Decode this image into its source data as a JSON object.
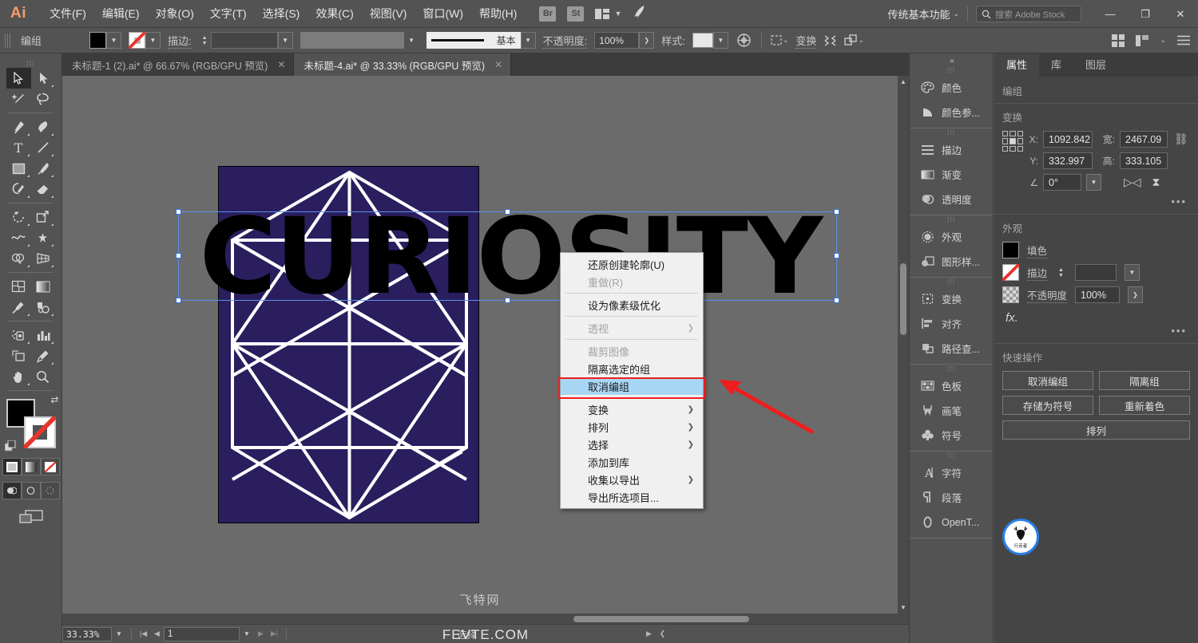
{
  "app": {
    "logo": "Ai",
    "menus": [
      "文件(F)",
      "编辑(E)",
      "对象(O)",
      "文字(T)",
      "选择(S)",
      "效果(C)",
      "视图(V)",
      "窗口(W)",
      "帮助(H)"
    ],
    "bridge_badge": "Br",
    "stock_badge": "St",
    "workspace": "传统基本功能",
    "search_placeholder": "搜索 Adobe Stock",
    "window_minimize": "—",
    "window_maximize": "❐",
    "window_close": "✕"
  },
  "control_bar": {
    "object_label": "编组",
    "stroke_label": "描边:",
    "stroke_weight": "",
    "stroke_profile": "基本",
    "opacity_label": "不透明度:",
    "opacity_value": "100%",
    "style_label": "样式:",
    "transform_label": "变换",
    "arrange_icon": "arrange-icon",
    "align_icon": "align-icon"
  },
  "tabs": [
    {
      "title": "未标题-1 (2).ai* @ 66.67% (RGB/GPU 预览)",
      "active": false,
      "close": "✕"
    },
    {
      "title": "未标题-4.ai* @ 33.33% (RGB/GPU 预览)",
      "active": true,
      "close": "✕"
    }
  ],
  "toolbar": {
    "tools": [
      {
        "name": "selection-tool",
        "selected": true,
        "corner": false
      },
      {
        "name": "direct-selection-tool",
        "selected": false,
        "corner": true
      },
      {
        "name": "magic-wand-tool",
        "selected": false,
        "corner": false
      },
      {
        "name": "lasso-tool",
        "selected": false,
        "corner": false
      },
      {
        "name": "pen-tool",
        "selected": false,
        "corner": true
      },
      {
        "name": "curvature-tool",
        "selected": false,
        "corner": true
      },
      {
        "name": "type-tool",
        "selected": false,
        "corner": true
      },
      {
        "name": "line-segment-tool",
        "selected": false,
        "corner": true
      },
      {
        "name": "rectangle-tool",
        "selected": false,
        "corner": true
      },
      {
        "name": "paintbrush-tool",
        "selected": false,
        "corner": true
      },
      {
        "name": "shaper-pencil-tool",
        "selected": false,
        "corner": true
      },
      {
        "name": "eraser-tool",
        "selected": false,
        "corner": true
      },
      {
        "name": "rotate-tool",
        "selected": false,
        "corner": true
      },
      {
        "name": "scale-tool",
        "selected": false,
        "corner": true
      },
      {
        "name": "width-tool",
        "selected": false,
        "corner": true
      },
      {
        "name": "free-transform-tool",
        "selected": false,
        "corner": true
      },
      {
        "name": "shape-builder-tool",
        "selected": false,
        "corner": true
      },
      {
        "name": "perspective-grid-tool",
        "selected": false,
        "corner": true
      },
      {
        "name": "mesh-tool",
        "selected": false,
        "corner": false
      },
      {
        "name": "gradient-tool",
        "selected": false,
        "corner": false
      },
      {
        "name": "eyedropper-tool",
        "selected": false,
        "corner": true
      },
      {
        "name": "blend-tool",
        "selected": false,
        "corner": true
      },
      {
        "name": "symbol-sprayer-tool",
        "selected": false,
        "corner": true
      },
      {
        "name": "column-graph-tool",
        "selected": false,
        "corner": true
      },
      {
        "name": "artboard-tool",
        "selected": false,
        "corner": false
      },
      {
        "name": "slice-tool",
        "selected": false,
        "corner": true
      },
      {
        "name": "hand-tool",
        "selected": false,
        "corner": true
      },
      {
        "name": "zoom-tool",
        "selected": false,
        "corner": false
      }
    ],
    "fill_color": "#000000",
    "stroke_color": "none"
  },
  "canvas": {
    "artboard_color": "#2a1e5f",
    "artwork_text": "CURIOSITY",
    "artwork_text_color": "#000000",
    "cube_line_color": "#ffffff",
    "selection_color": "#5b8fe8",
    "watermark_cn": "飞特网",
    "watermark_en": "FEVTE.COM"
  },
  "context_menu": {
    "items": [
      {
        "label": "还原创建轮廓(U)",
        "disabled": false,
        "submenu": false,
        "highlighted": false,
        "sep_after": false
      },
      {
        "label": "重做(R)",
        "disabled": true,
        "submenu": false,
        "highlighted": false,
        "sep_after": true
      },
      {
        "label": "设为像素级优化",
        "disabled": false,
        "submenu": false,
        "highlighted": false,
        "sep_after": true
      },
      {
        "label": "透视",
        "disabled": true,
        "submenu": true,
        "highlighted": false,
        "sep_after": true
      },
      {
        "label": "裁剪图像",
        "disabled": true,
        "submenu": false,
        "highlighted": false,
        "sep_after": false
      },
      {
        "label": "隔离选定的组",
        "disabled": false,
        "submenu": false,
        "highlighted": false,
        "sep_after": false
      },
      {
        "label": "取消编组",
        "disabled": false,
        "submenu": false,
        "highlighted": true,
        "sep_after": true
      },
      {
        "label": "变换",
        "disabled": false,
        "submenu": true,
        "highlighted": false,
        "sep_after": false
      },
      {
        "label": "排列",
        "disabled": false,
        "submenu": true,
        "highlighted": false,
        "sep_after": false
      },
      {
        "label": "选择",
        "disabled": false,
        "submenu": true,
        "highlighted": false,
        "sep_after": false
      },
      {
        "label": "添加到库",
        "disabled": false,
        "submenu": false,
        "highlighted": false,
        "sep_after": false
      },
      {
        "label": "收集以导出",
        "disabled": false,
        "submenu": true,
        "highlighted": false,
        "sep_after": false
      },
      {
        "label": "导出所选项目...",
        "disabled": false,
        "submenu": false,
        "highlighted": false,
        "sep_after": false
      }
    ],
    "highlight_color": "#a8d6f5",
    "annotation_color": "#ef1d1d"
  },
  "dock": {
    "groups": [
      {
        "items": [
          {
            "label": "颜色",
            "icon": "color-palette-icon"
          },
          {
            "label": "颜色参...",
            "icon": "color-guide-icon"
          }
        ]
      },
      {
        "items": [
          {
            "label": "描边",
            "icon": "stroke-icon"
          },
          {
            "label": "渐变",
            "icon": "gradient-icon"
          },
          {
            "label": "透明度",
            "icon": "transparency-icon"
          }
        ]
      },
      {
        "items": [
          {
            "label": "外观",
            "icon": "appearance-icon"
          },
          {
            "label": "图形样...",
            "icon": "graphic-styles-icon"
          }
        ]
      },
      {
        "items": [
          {
            "label": "变换",
            "icon": "transform-icon"
          },
          {
            "label": "对齐",
            "icon": "align-icon"
          },
          {
            "label": "路径查...",
            "icon": "pathfinder-icon"
          }
        ]
      },
      {
        "items": [
          {
            "label": "色板",
            "icon": "swatches-icon"
          },
          {
            "label": "画笔",
            "icon": "brushes-icon"
          },
          {
            "label": "符号",
            "icon": "symbols-icon"
          }
        ]
      },
      {
        "items": [
          {
            "label": "字符",
            "icon": "character-icon"
          },
          {
            "label": "段落",
            "icon": "paragraph-icon"
          },
          {
            "label": "OpenT...",
            "icon": "opentype-icon"
          }
        ]
      }
    ]
  },
  "properties": {
    "tabs": [
      {
        "label": "属性",
        "active": true
      },
      {
        "label": "库",
        "active": false
      },
      {
        "label": "图层",
        "active": false
      }
    ],
    "object_type": "编组",
    "transform": {
      "title": "变换",
      "x_label": "X:",
      "x_value": "1092.842",
      "y_label": "Y:",
      "y_value": "332.997",
      "w_label": "宽:",
      "w_value": "2467.09",
      "h_label": "高:",
      "h_value": "333.105",
      "angle_value": "0°",
      "more": "•••"
    },
    "appearance": {
      "title": "外观",
      "fill_label": "填色",
      "stroke_label": "描边",
      "stroke_weight": "",
      "opacity_label": "不透明度",
      "opacity_value": "100%",
      "fx_label": "fx.",
      "more": "•••"
    },
    "quick_actions": {
      "title": "快速操作",
      "buttons": [
        "取消编组",
        "隔离组",
        "存储为符号",
        "重新着色",
        "排列"
      ]
    },
    "badge_text": "行走者"
  },
  "status_bar": {
    "zoom": "33.33%",
    "page": "1",
    "status": "选择",
    "first_icon": "|◀",
    "prev_icon": "◀",
    "next_icon": "▶",
    "last_icon": "▶|"
  }
}
